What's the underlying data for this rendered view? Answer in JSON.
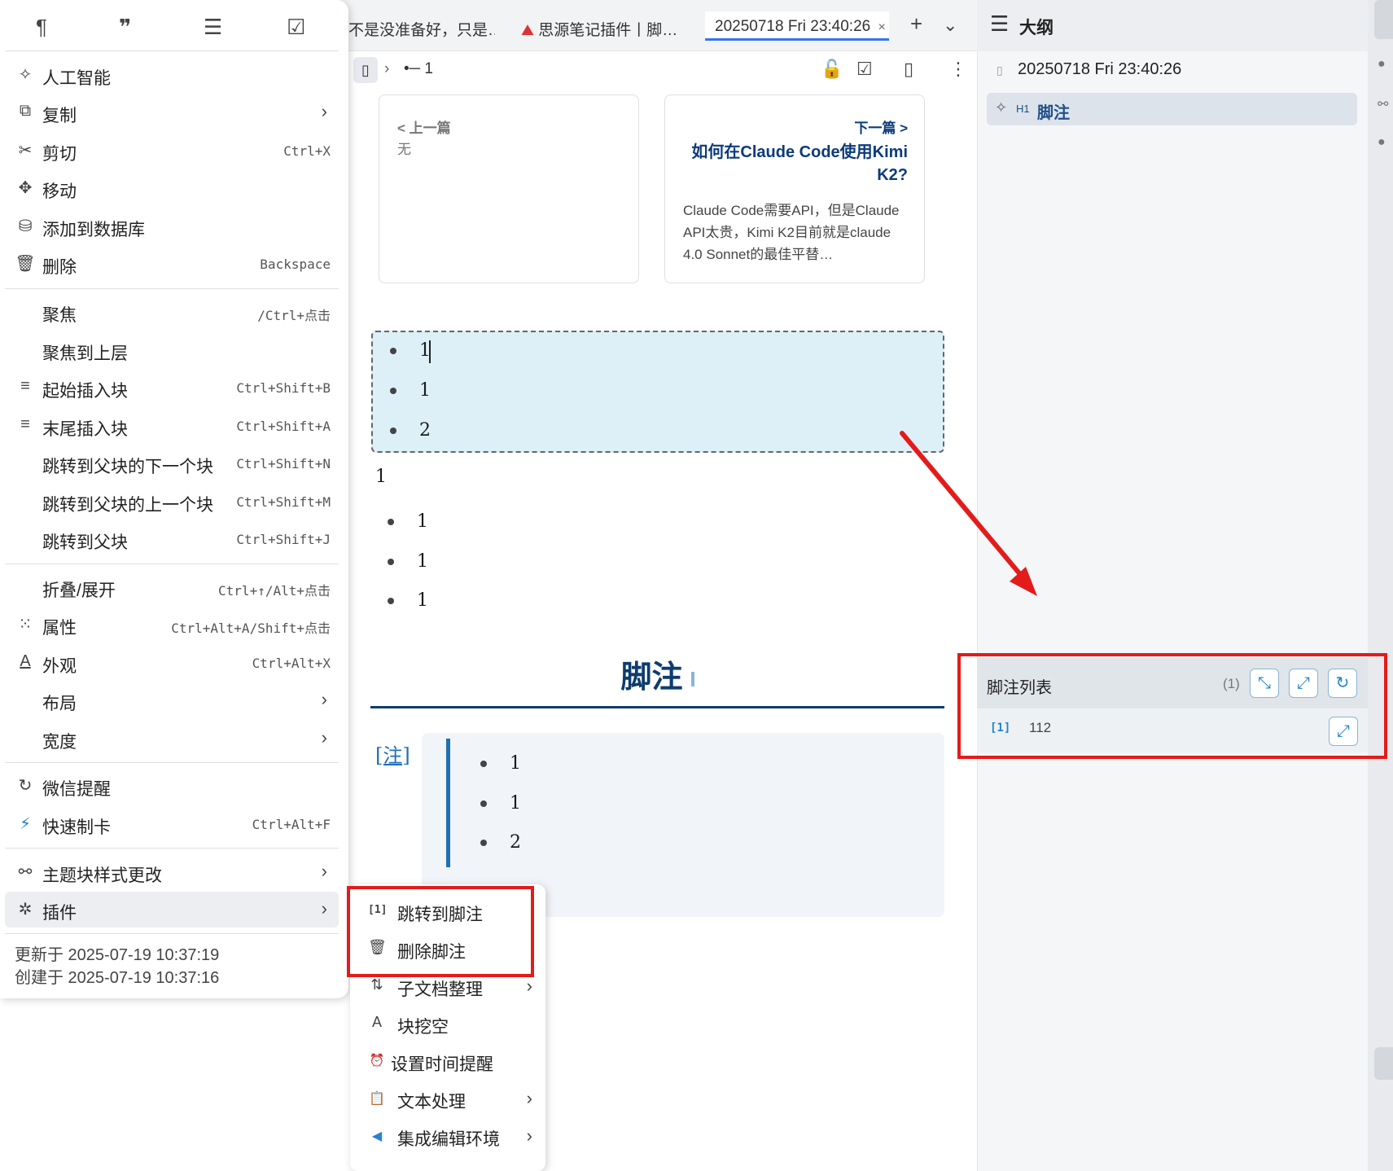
{
  "tabs": [
    {
      "label": "不是没准备好，只是…",
      "active": false
    },
    {
      "label": "思源笔记插件丨脚…",
      "active": false
    },
    {
      "label": "20250718 Fri 23:40:26",
      "active": true
    }
  ],
  "tab_close": "×",
  "breadcrumb": {
    "item": "•─ 1"
  },
  "prev_card": {
    "label": "< 上一篇",
    "value": "无"
  },
  "next_card": {
    "label": "下一篇 >",
    "title": "如何在Claude Code使用Kimi K2?",
    "desc": "Claude Code需要API，但是Claude API太贵，Kimi K2目前就是claude 4.0 Sonnet的最佳平替…"
  },
  "doc": {
    "selected_list": [
      "1",
      "1",
      "2"
    ],
    "paragraph": "1",
    "list": [
      "1",
      "1",
      "1"
    ],
    "footnote_heading": "脚注",
    "footnote_ref": "[注]",
    "footnote_list": [
      "1",
      "1",
      "2"
    ]
  },
  "menu": {
    "items": [
      {
        "icon": "✧",
        "label": "人工智能",
        "shortcut": "",
        "arrow": false
      },
      {
        "icon": "⧉",
        "label": "复制",
        "shortcut": "",
        "arrow": true
      },
      {
        "icon": "✂",
        "label": "剪切",
        "shortcut": "Ctrl+X",
        "arrow": false
      },
      {
        "icon": "✥",
        "label": "移动",
        "shortcut": "",
        "arrow": false
      },
      {
        "icon": "⛁",
        "label": "添加到数据库",
        "shortcut": "",
        "arrow": false
      },
      {
        "icon": "🗑",
        "label": "删除",
        "shortcut": "Backspace",
        "arrow": false
      },
      {
        "icon": "",
        "label": "聚焦",
        "shortcut": "/Ctrl+点击",
        "arrow": false
      },
      {
        "icon": "",
        "label": "聚焦到上层",
        "shortcut": "",
        "arrow": false
      },
      {
        "icon": "≡",
        "label": "起始插入块",
        "shortcut": "Ctrl+Shift+B",
        "arrow": false
      },
      {
        "icon": "≡",
        "label": "末尾插入块",
        "shortcut": "Ctrl+Shift+A",
        "arrow": false
      },
      {
        "icon": "",
        "label": "跳转到父块的下一个块",
        "shortcut": "Ctrl+Shift+N",
        "arrow": false
      },
      {
        "icon": "",
        "label": "跳转到父块的上一个块",
        "shortcut": "Ctrl+Shift+M",
        "arrow": false
      },
      {
        "icon": "",
        "label": "跳转到父块",
        "shortcut": "Ctrl+Shift+J",
        "arrow": false
      },
      {
        "icon": "",
        "label": "折叠/展开",
        "shortcut": "Ctrl+↑/Alt+点击",
        "arrow": false
      },
      {
        "icon": "⁙",
        "label": "属性",
        "shortcut": "Ctrl+Alt+A/Shift+点击",
        "arrow": false
      },
      {
        "icon": "A",
        "label": "外观",
        "shortcut": "Ctrl+Alt+X",
        "arrow": false
      },
      {
        "icon": "",
        "label": "布局",
        "shortcut": "",
        "arrow": true
      },
      {
        "icon": "",
        "label": "宽度",
        "shortcut": "",
        "arrow": true
      },
      {
        "icon": "↻",
        "label": "微信提醒",
        "shortcut": "",
        "arrow": false
      },
      {
        "icon": "⚡",
        "label": "快速制卡",
        "shortcut": "Ctrl+Alt+F",
        "arrow": false
      },
      {
        "icon": "⚯",
        "label": "主题块样式更改",
        "shortcut": "",
        "arrow": true
      },
      {
        "icon": "✲",
        "label": "插件",
        "shortcut": "",
        "arrow": true
      }
    ],
    "updated": "更新于 2025-07-19 10:37:19",
    "created": "创建于 2025-07-19 10:37:16"
  },
  "submenu": {
    "items": [
      {
        "icon": "[1]",
        "label": "跳转到脚注",
        "arrow": false
      },
      {
        "icon": "🗑",
        "label": "删除脚注",
        "arrow": false
      },
      {
        "icon": "⇅",
        "label": "子文档整理",
        "arrow": true
      },
      {
        "icon": "A",
        "label": "块挖空",
        "arrow": false
      },
      {
        "icon": "⏰",
        "label": "设置时间提醒",
        "arrow": false
      },
      {
        "icon": "📋",
        "label": "文本处理",
        "arrow": true
      },
      {
        "icon": "◀",
        "label": "集成编辑环境",
        "arrow": true
      }
    ]
  },
  "outline": {
    "title": "大纲",
    "doc_title": "20250718 Fri 23:40:26",
    "heading_level": "H1",
    "heading": "脚注"
  },
  "footnote_panel": {
    "title": "脚注列表",
    "count": "(1)",
    "ref": "[1]",
    "content": "112"
  },
  "colors": {
    "accent": "#3575f0",
    "heading": "#0e3c6e",
    "annotation_red": "#e41b1b",
    "selection": "#ddf0f8"
  }
}
